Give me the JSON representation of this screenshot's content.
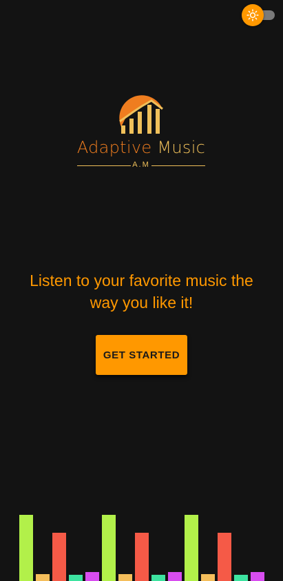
{
  "theme_toggle": {
    "icon": "sun-icon",
    "state": "off",
    "thumb_color": "#ff9800"
  },
  "logo": {
    "title_part1": "Adaptive",
    "title_part2": "Music",
    "abbreviation": "A.M",
    "colors": {
      "orange": "#ef7d1f",
      "gold": "#f0c05a"
    }
  },
  "tagline": "Listen to your favorite music the way you like it!",
  "get_started_label": "GET STARTED",
  "equalizer": {
    "palette": [
      "#b2f04a",
      "#f5be5b",
      "#f55a47",
      "#3de3a0",
      "#d84df0"
    ],
    "group_levels": [
      0.96,
      0.1,
      0.7,
      0.09,
      0.13
    ]
  },
  "colors": {
    "background": "#131313",
    "accent": "#ff9800"
  }
}
